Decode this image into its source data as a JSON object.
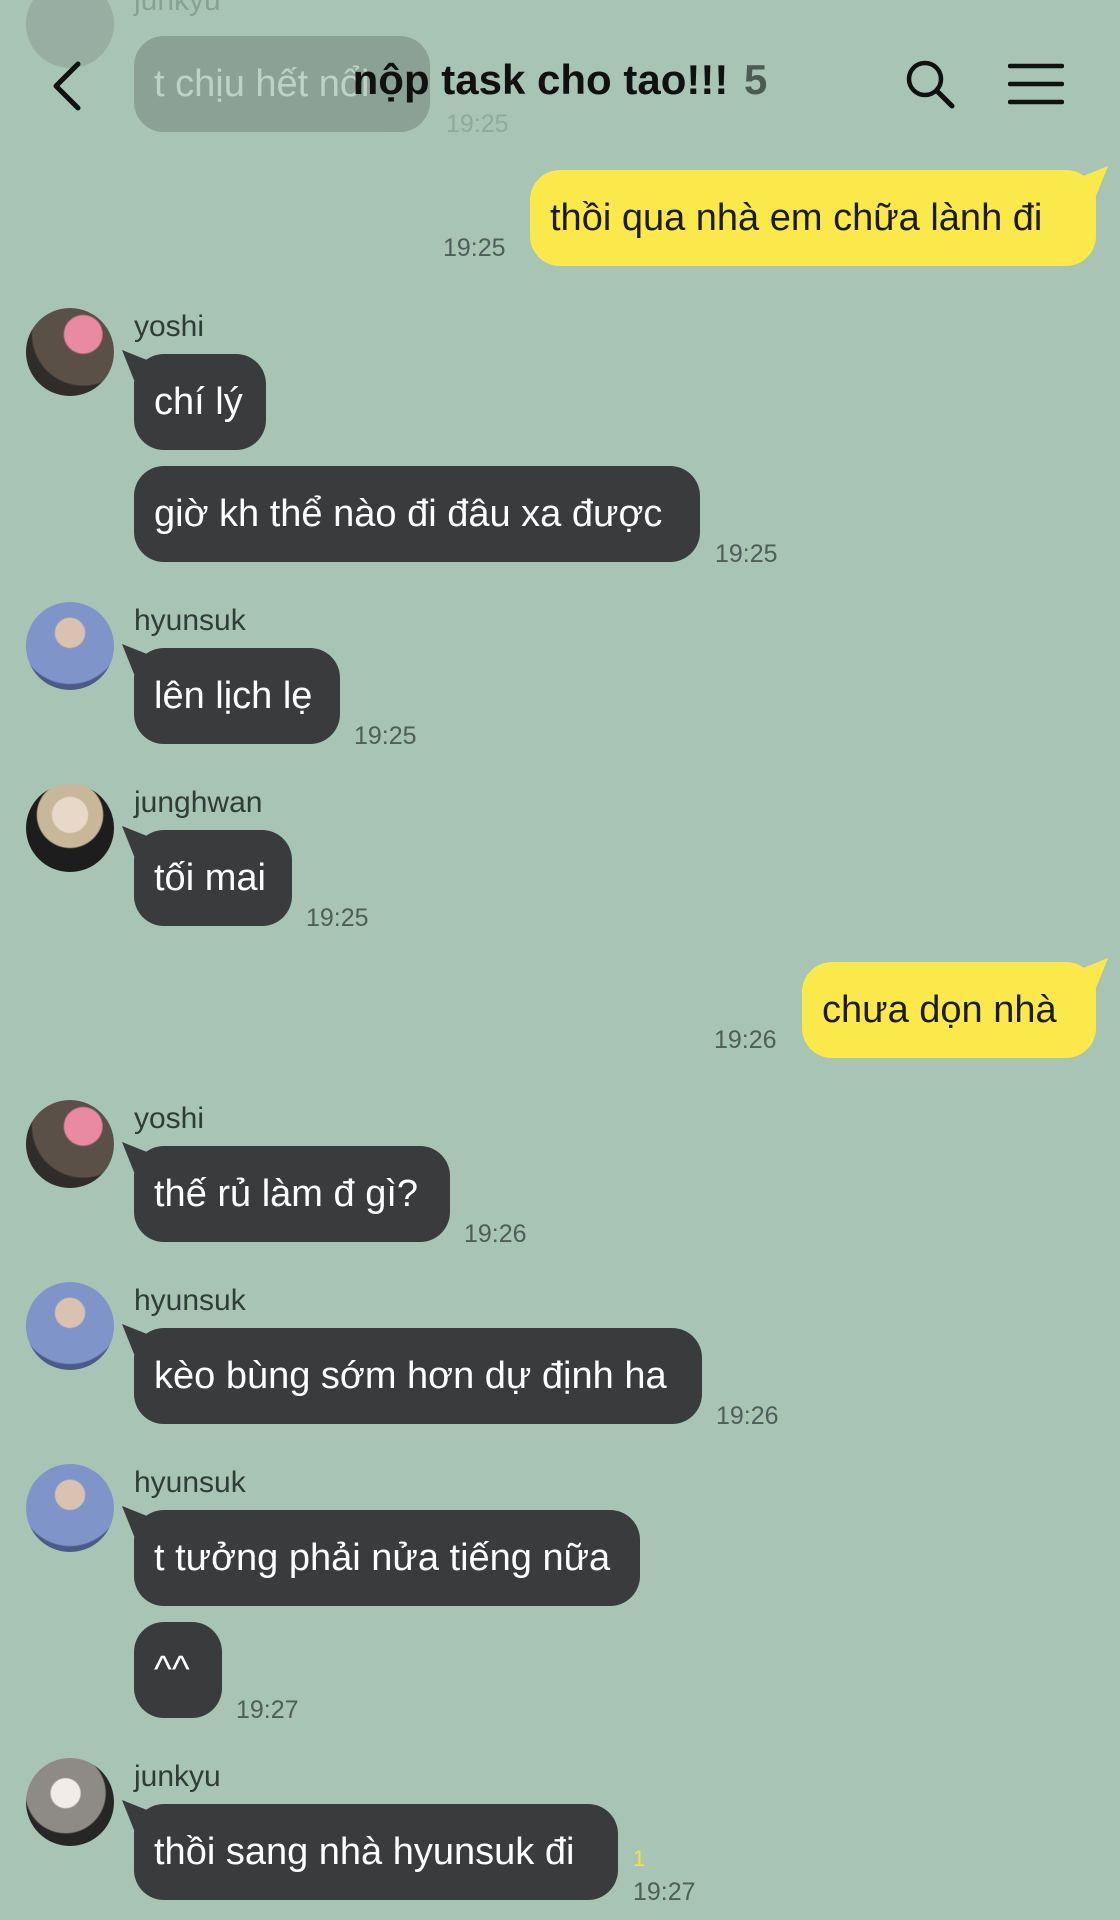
{
  "header": {
    "title": "nộp task cho tao!!!",
    "member_count": "5",
    "back_icon": "chevron-left-icon",
    "search_icon": "search-icon",
    "menu_icon": "hamburger-menu-icon"
  },
  "scrolled_message": {
    "sender": "junkyu",
    "text": "t chịu hết nổi",
    "time": "19:25"
  },
  "messages": [
    {
      "from": "me",
      "text": "thồi qua nhà em chữa lành đi",
      "time": "19:25"
    },
    {
      "from": "yoshi",
      "sender": "yoshi",
      "text": "chí lý"
    },
    {
      "from": "yoshi",
      "text": "giờ kh thể nào đi đâu xa được",
      "time": "19:25"
    },
    {
      "from": "hyunsuk",
      "sender": "hyunsuk",
      "text": "lên lịch lẹ",
      "time": "19:25"
    },
    {
      "from": "junghwan",
      "sender": "junghwan",
      "text": "tối mai",
      "time": "19:25"
    },
    {
      "from": "me",
      "text": "chưa dọn nhà",
      "time": "19:26"
    },
    {
      "from": "yoshi",
      "sender": "yoshi",
      "text": "thế rủ làm đ gì?",
      "time": "19:26"
    },
    {
      "from": "hyunsuk",
      "sender": "hyunsuk",
      "text": "kèo bùng sớm hơn dự định ha",
      "time": "19:26"
    },
    {
      "from": "hyunsuk",
      "sender": "hyunsuk",
      "text": "t tưởng phải nửa tiếng nữa"
    },
    {
      "from": "hyunsuk",
      "text": "^^",
      "time": "19:27"
    },
    {
      "from": "junkyu",
      "sender": "junkyu",
      "text": "thồi sang nhà hyunsuk đi",
      "time": "19:27",
      "unread": "1"
    }
  ],
  "colors": {
    "background": "#a7c4b4",
    "incoming_bubble": "#3a3b3d",
    "outgoing_bubble": "#fbe94b",
    "unread_count": "#f2e640"
  }
}
